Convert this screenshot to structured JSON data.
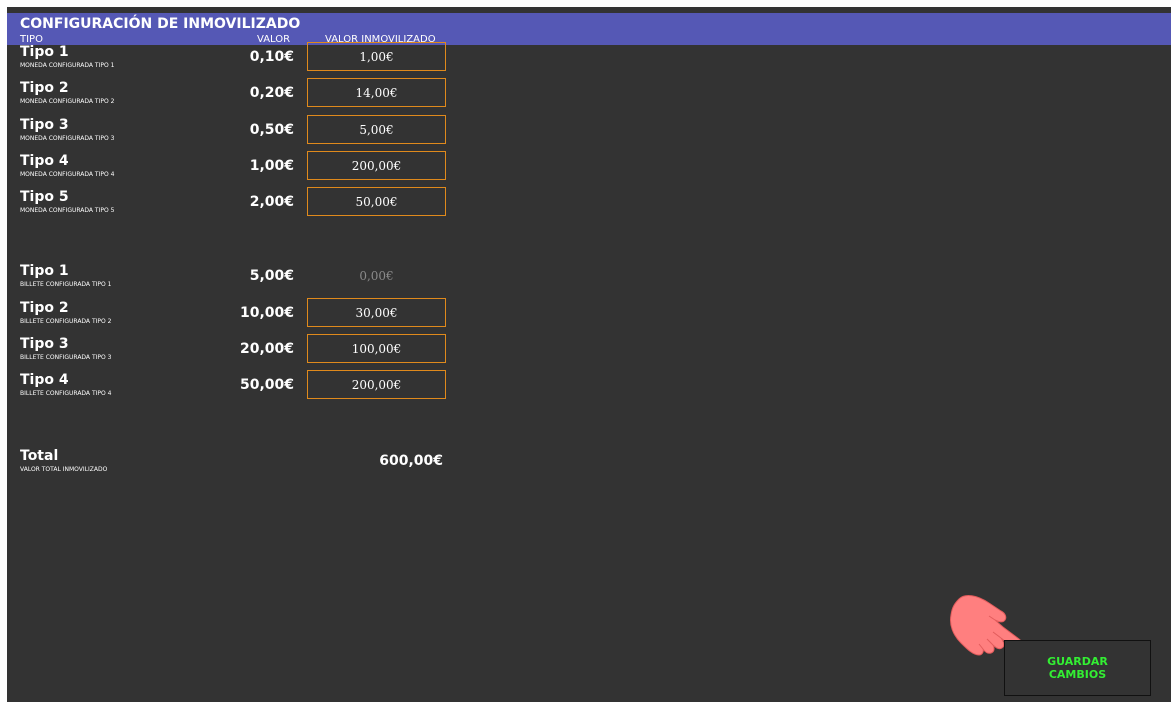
{
  "header": {
    "title": "CONFIGURACIÓN DE INMOVILIZADO",
    "col_tipo": "TIPO",
    "col_valor": "VALOR",
    "col_inmovilizado": "VALOR INMOVILIZADO"
  },
  "monedas": [
    {
      "name": "Tipo 1",
      "sub": "MONEDA CONFIGURADA TIPO 1",
      "valor": "0,10€",
      "inmovilizado": "1,00€"
    },
    {
      "name": "Tipo 2",
      "sub": "MONEDA CONFIGURADA TIPO 2",
      "valor": "0,20€",
      "inmovilizado": "14,00€"
    },
    {
      "name": "Tipo 3",
      "sub": "MONEDA CONFIGURADA TIPO 3",
      "valor": "0,50€",
      "inmovilizado": "5,00€"
    },
    {
      "name": "Tipo 4",
      "sub": "MONEDA CONFIGURADA TIPO 4",
      "valor": "1,00€",
      "inmovilizado": "200,00€"
    },
    {
      "name": "Tipo 5",
      "sub": "MONEDA CONFIGURADA TIPO 5",
      "valor": "2,00€",
      "inmovilizado": "50,00€"
    }
  ],
  "billetes": [
    {
      "name": "Tipo 1",
      "sub": "BILLETE CONFIGURADA TIPO 1",
      "valor": "5,00€",
      "inmovilizado": "0,00€"
    },
    {
      "name": "Tipo 2",
      "sub": "BILLETE CONFIGURADA TIPO 2",
      "valor": "10,00€",
      "inmovilizado": "30,00€"
    },
    {
      "name": "Tipo 3",
      "sub": "BILLETE CONFIGURADA TIPO 3",
      "valor": "20,00€",
      "inmovilizado": "100,00€"
    },
    {
      "name": "Tipo 4",
      "sub": "BILLETE CONFIGURADA TIPO 4",
      "valor": "50,00€",
      "inmovilizado": "200,00€"
    }
  ],
  "total": {
    "label": "Total",
    "sub": "VALOR TOTAL INMOVILIZADO",
    "value": "600,00€"
  },
  "save_button": {
    "label": "GUARDAR CAMBIOS"
  },
  "colors": {
    "header_bg": "#5558b5",
    "panel_bg": "#333333",
    "input_border": "#e08a1c",
    "save_text": "#33ee33",
    "hand": "#ff7f7f"
  },
  "icons": {
    "pointer": "pointing-hand-icon"
  }
}
